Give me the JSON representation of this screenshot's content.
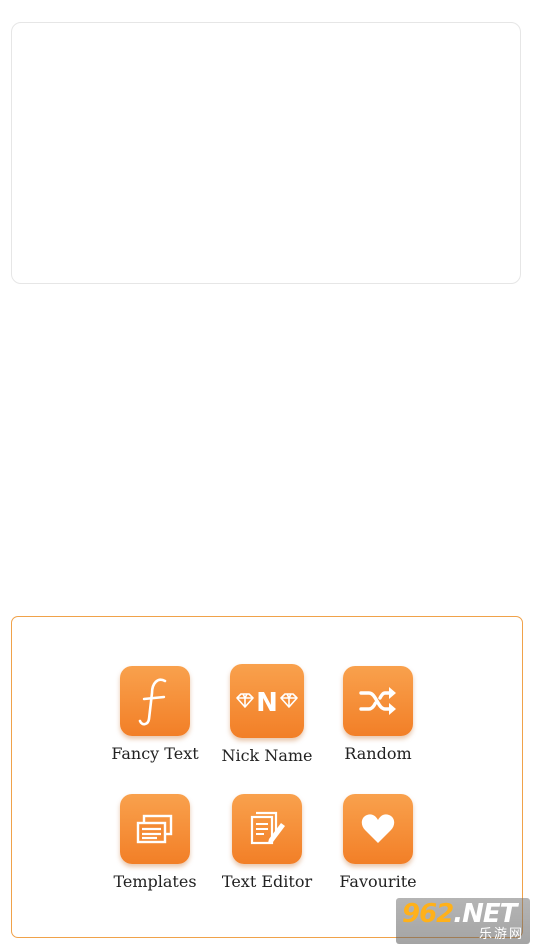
{
  "menu": {
    "items": [
      {
        "label": "Fancy Text",
        "icon": "fancy-f-icon"
      },
      {
        "label": "Nick Name",
        "icon": "nick-name-icon",
        "icon_text": "N"
      },
      {
        "label": "Random",
        "icon": "shuffle-icon"
      },
      {
        "label": "Templates",
        "icon": "templates-icon"
      },
      {
        "label": "Text Editor",
        "icon": "text-editor-icon"
      },
      {
        "label": "Favourite",
        "icon": "heart-icon"
      }
    ]
  },
  "watermark": {
    "brand_digits": "962",
    "brand_suffix": ".NET",
    "subtitle": "乐游网"
  },
  "colors": {
    "accent": "#f27f27",
    "accent_light": "#f9a14d",
    "panel_border": "#f0a24a",
    "card_border": "#e6e6e6"
  }
}
